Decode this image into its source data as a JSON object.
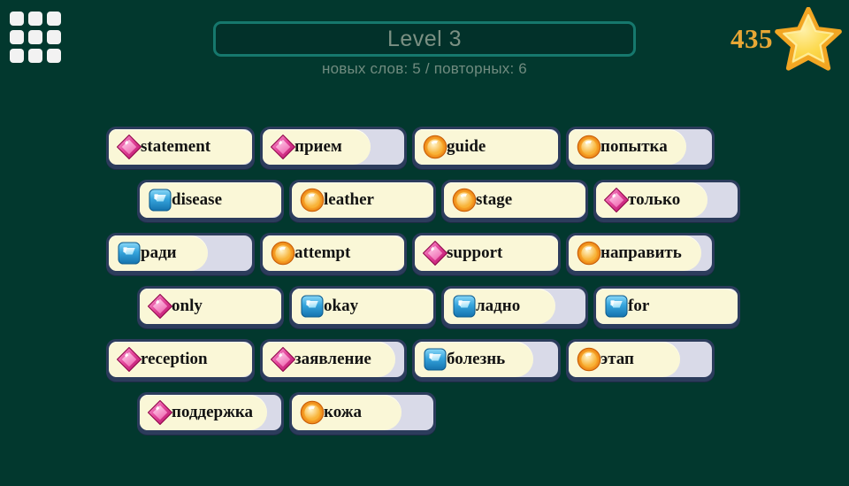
{
  "header": {
    "menu_icon": "grid-menu-icon",
    "level_title": "Level 3",
    "subtitle": "новых слов: 5 / повторных: 6",
    "score": "435",
    "star_icon": "star-icon"
  },
  "colors": {
    "background": "#02382E",
    "panel_border": "#16786D",
    "level_text": "#7B9083",
    "subtitle_text": "#708B7F",
    "score_text": "#E8A735",
    "star_fill": "#FBD74B",
    "star_outline": "#F0A526",
    "tile_frame": "#2C3C5C",
    "tile_fill": "#FAF7D7",
    "tile_track": "#D9DAE8",
    "tile_text": "#131313",
    "gem_pink": "#D6137E",
    "gem_orange": "#F5A623",
    "gem_blue": "#2E9BD6"
  },
  "board": {
    "rows": [
      {
        "indent": "a",
        "tiles": [
          {
            "label": "statement",
            "gem": "diamond-pink-gem-icon",
            "width": 168,
            "fill": 168
          },
          {
            "label": "прием",
            "gem": "diamond-pink-gem-icon",
            "width": 166,
            "fill": 122
          },
          {
            "label": "guide",
            "gem": "coin-orange-gem-icon",
            "width": 168,
            "fill": 168
          },
          {
            "label": "попытка",
            "gem": "coin-orange-gem-icon",
            "width": 168,
            "fill": 133
          }
        ]
      },
      {
        "indent": "b",
        "tiles": [
          {
            "label": "disease",
            "gem": "square-blue-gem-icon",
            "width": 166,
            "fill": 166
          },
          {
            "label": "leather",
            "gem": "coin-orange-gem-icon",
            "width": 166,
            "fill": 166
          },
          {
            "label": "stage",
            "gem": "coin-orange-gem-icon",
            "width": 166,
            "fill": 166
          },
          {
            "label": "только",
            "gem": "diamond-pink-gem-icon",
            "width": 166,
            "fill": 126
          }
        ]
      },
      {
        "indent": "a",
        "tiles": [
          {
            "label": "ради",
            "gem": "square-blue-gem-icon",
            "width": 168,
            "fill": 112
          },
          {
            "label": "attempt",
            "gem": "coin-orange-gem-icon",
            "width": 166,
            "fill": 166
          },
          {
            "label": "support",
            "gem": "diamond-pink-gem-icon",
            "width": 168,
            "fill": 168
          },
          {
            "label": "направить",
            "gem": "coin-orange-gem-icon",
            "width": 168,
            "fill": 150
          }
        ]
      },
      {
        "indent": "b",
        "tiles": [
          {
            "label": "only",
            "gem": "diamond-pink-gem-icon",
            "width": 166,
            "fill": 166
          },
          {
            "label": "okay",
            "gem": "square-blue-gem-icon",
            "width": 166,
            "fill": 166
          },
          {
            "label": "ладно",
            "gem": "square-blue-gem-icon",
            "width": 166,
            "fill": 126
          },
          {
            "label": "for",
            "gem": "square-blue-gem-icon",
            "width": 166,
            "fill": 166
          }
        ]
      },
      {
        "indent": "a",
        "tiles": [
          {
            "label": "reception",
            "gem": "diamond-pink-gem-icon",
            "width": 168,
            "fill": 168
          },
          {
            "label": "заявление",
            "gem": "diamond-pink-gem-icon",
            "width": 166,
            "fill": 150
          },
          {
            "label": "болезнь",
            "gem": "square-blue-gem-icon",
            "width": 168,
            "fill": 134
          },
          {
            "label": "этап",
            "gem": "coin-orange-gem-icon",
            "width": 168,
            "fill": 126
          }
        ]
      },
      {
        "indent": "b",
        "tiles": [
          {
            "label": "поддержка",
            "gem": "diamond-pink-gem-icon",
            "width": 166,
            "fill": 144
          },
          {
            "label": "кожа",
            "gem": "coin-orange-gem-icon",
            "width": 166,
            "fill": 124
          }
        ]
      }
    ]
  }
}
